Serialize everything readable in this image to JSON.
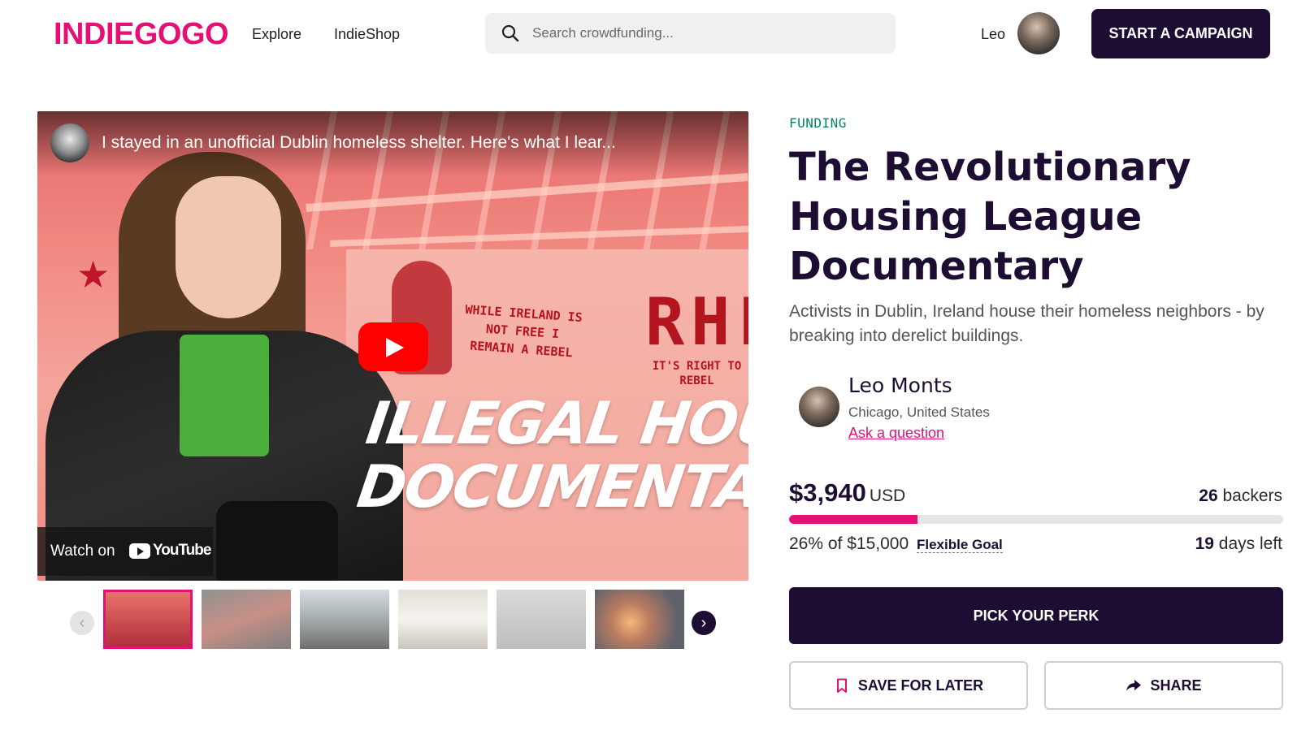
{
  "header": {
    "logo": "INDIEGOGO",
    "nav": {
      "explore": "Explore",
      "indieshop": "IndieShop"
    },
    "search": {
      "placeholder": "Search crowdfunding..."
    },
    "user": {
      "name": "Leo"
    },
    "start_campaign_label": "START A CAMPAIGN"
  },
  "video": {
    "title": "I stayed in an unofficial Dublin homeless shelter. Here's what I lear...",
    "overlay_title_line1": "ILLEGAL HOUSIN",
    "overlay_title_line2": "DOCUMENTARY",
    "wall_text_1": "WHILE IRELAND IS NOT FREE I REMAIN A REBEL",
    "wall_text_2": "RHL",
    "wall_text_3": "IT'S RIGHT TO REBEL",
    "watch_on_label": "Watch on",
    "youtube_label": "YouTube",
    "thumbnails_count": 6,
    "selected_thumbnail": 1
  },
  "campaign": {
    "status": "FUNDING",
    "title": "The Revolutionary Housing League Documentary",
    "description": "Activists in Dublin, Ireland house their homeless neighbors - by breaking into derelict buildings.",
    "owner": {
      "name": "Leo Monts",
      "location": "Chicago, United States",
      "ask_link": "Ask a question"
    },
    "funding": {
      "amount": "$3,940",
      "currency": "USD",
      "backers_count": "26",
      "backers_label": "backers",
      "percent_text": "26% of $15,000",
      "goal_type": "Flexible Goal",
      "days_count": "19",
      "days_label": "days left",
      "progress_fraction": 0.26
    },
    "buttons": {
      "pick_perk": "PICK YOUR PERK",
      "save_for_later": "SAVE FOR LATER",
      "share": "SHARE"
    }
  },
  "colors": {
    "brand_pink": "#e51075",
    "dark_purple": "#1e0d33",
    "funding_green": "#088366"
  }
}
